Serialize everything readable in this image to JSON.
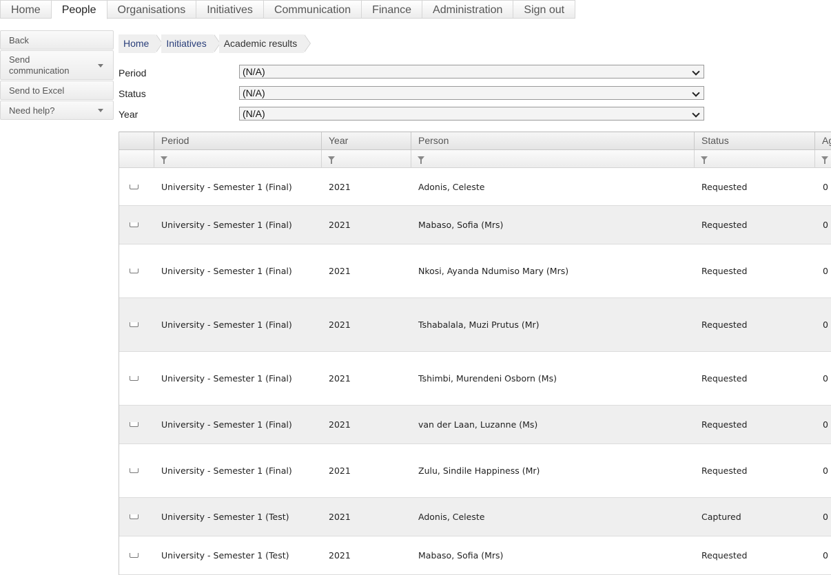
{
  "nav": {
    "tabs": [
      "Home",
      "People",
      "Organisations",
      "Initiatives",
      "Communication",
      "Finance",
      "Administration",
      "Sign out"
    ],
    "active_tab": "People"
  },
  "sidebar": {
    "back": "Back",
    "send_communication": "Send communication",
    "send_to_excel": "Send to Excel",
    "need_help": "Need help?"
  },
  "breadcrumb": [
    "Home",
    "Initiatives",
    "Academic results"
  ],
  "filters": {
    "period": {
      "label": "Period",
      "value": "(N/A)"
    },
    "status": {
      "label": "Status",
      "value": "(N/A)"
    },
    "year": {
      "label": "Year",
      "value": "(N/A)"
    }
  },
  "grid": {
    "columns": [
      "Period",
      "Year",
      "Person",
      "Status",
      "Ag"
    ],
    "rows": [
      {
        "period": "University - Semester 1 (Final)",
        "year": "2021",
        "person": "Adonis, Celeste",
        "status": "Requested",
        "ag": "0"
      },
      {
        "period": "University - Semester 1 (Final)",
        "year": "2021",
        "person": "Mabaso, Sofia (Mrs)",
        "status": "Requested",
        "ag": "0"
      },
      {
        "period": "University - Semester 1 (Final)",
        "year": "2021",
        "person": "Nkosi, Ayanda Ndumiso Mary (Mrs)",
        "status": "Requested",
        "ag": "0"
      },
      {
        "period": "University - Semester 1 (Final)",
        "year": "2021",
        "person": "Tshabalala, Muzi Prutus (Mr)",
        "status": "Requested",
        "ag": "0"
      },
      {
        "period": "University - Semester 1 (Final)",
        "year": "2021",
        "person": "Tshimbi, Murendeni Osborn (Ms)",
        "status": "Requested",
        "ag": "0"
      },
      {
        "period": "University - Semester 1 (Final)",
        "year": "2021",
        "person": "van der Laan, Luzanne (Ms)",
        "status": "Requested",
        "ag": "0"
      },
      {
        "period": "University - Semester 1 (Final)",
        "year": "2021",
        "person": "Zulu, Sindile Happiness (Mr)",
        "status": "Requested",
        "ag": "0"
      },
      {
        "period": "University - Semester 1 (Test)",
        "year": "2021",
        "person": "Adonis, Celeste",
        "status": "Captured",
        "ag": "0"
      },
      {
        "period": "University - Semester 1 (Test)",
        "year": "2021",
        "person": "Mabaso, Sofia (Mrs)",
        "status": "Requested",
        "ag": "0"
      }
    ]
  }
}
